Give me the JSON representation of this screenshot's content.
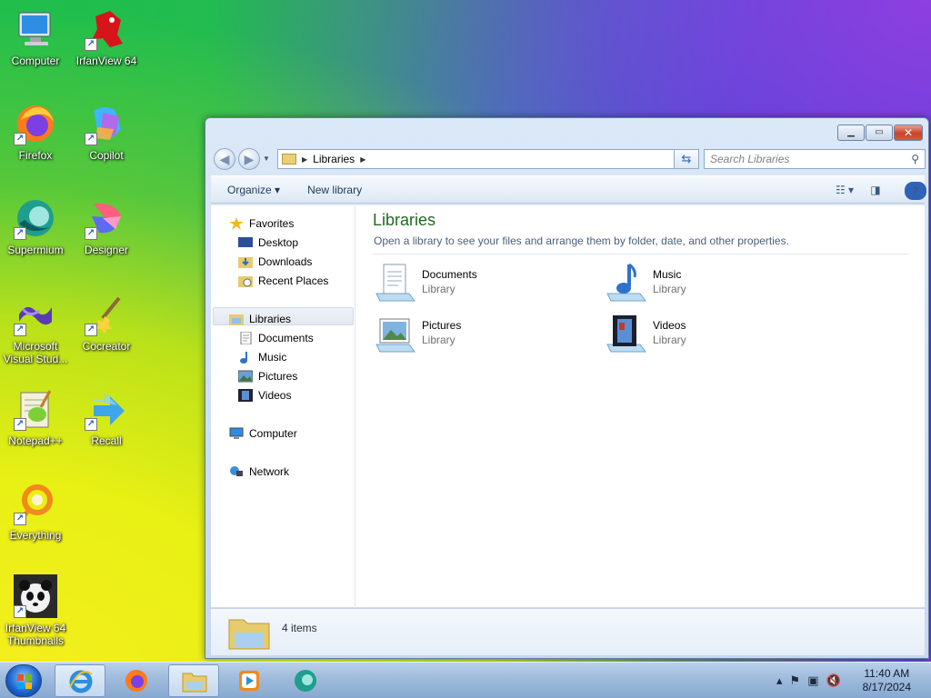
{
  "desktop": {
    "icons": [
      {
        "label": "Computer"
      },
      {
        "label": "IrfanView 64"
      },
      {
        "label": "Firefox"
      },
      {
        "label": "Copilot"
      },
      {
        "label": "Supermium"
      },
      {
        "label": "Designer"
      },
      {
        "label": "Microsoft Visual Stud..."
      },
      {
        "label": "Cocreator"
      },
      {
        "label": "Notepad++"
      },
      {
        "label": "Recall"
      },
      {
        "label": "Everything"
      },
      {
        "label": "IrfanView 64 Thumbnails"
      }
    ]
  },
  "window": {
    "address": {
      "segment": "Libraries"
    },
    "search": {
      "placeholder": "Search Libraries"
    },
    "toolbar": {
      "organize": "Organize ▾",
      "new_library": "New library"
    },
    "nav": {
      "favorites": "Favorites",
      "desktop": "Desktop",
      "downloads": "Downloads",
      "recent_places": "Recent Places",
      "libraries": "Libraries",
      "documents": "Documents",
      "music": "Music",
      "pictures": "Pictures",
      "videos": "Videos",
      "computer": "Computer",
      "network": "Network"
    },
    "content": {
      "title": "Libraries",
      "description": "Open a library to see your files and arrange them by folder, date, and other properties.",
      "items": [
        {
          "name": "Documents",
          "type": "Library"
        },
        {
          "name": "Music",
          "type": "Library"
        },
        {
          "name": "Pictures",
          "type": "Library"
        },
        {
          "name": "Videos",
          "type": "Library"
        }
      ]
    },
    "details": {
      "count": "4 items"
    }
  },
  "taskbar": {
    "clock": {
      "time": "11:40 AM",
      "date": "8/17/2024"
    }
  },
  "colors": {
    "accent_title": "#1e6c1e",
    "selection": "#e2e8ef",
    "close_button": "#c8432b"
  }
}
